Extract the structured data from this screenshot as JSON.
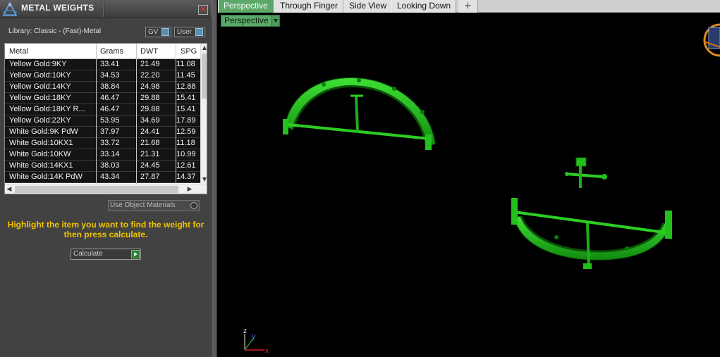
{
  "panel": {
    "title": "METAL WEIGHTS",
    "close_glyph": "✕",
    "library_label": "Library: Classic - (Fast)-Metal",
    "gv_label": "GV",
    "user_label": "User",
    "table": {
      "headers": [
        "Metal",
        "Grams",
        "DWT",
        "SPG"
      ],
      "rows": [
        [
          "Yellow Gold:9KY",
          "33.41",
          "21.49",
          "11.08"
        ],
        [
          "Yellow Gold:10KY",
          "34.53",
          "22.20",
          "11.45"
        ],
        [
          "Yellow Gold:14KY",
          "38.84",
          "24.98",
          "12.88"
        ],
        [
          "Yellow Gold:18KY",
          "46.47",
          "29.88",
          "15.41"
        ],
        [
          "Yellow Gold:18KY R...",
          "46.47",
          "29.88",
          "15.41"
        ],
        [
          "Yellow Gold:22KY",
          "53.95",
          "34.69",
          "17.89"
        ],
        [
          "White Gold:9K PdW",
          "37.97",
          "24.41",
          "12.59"
        ],
        [
          "White Gold:10KX1",
          "33.72",
          "21.68",
          "11.18"
        ],
        [
          "White Gold:10KW",
          "33.14",
          "21.31",
          "10.99"
        ],
        [
          "White Gold:14KX1",
          "38.03",
          "24.45",
          "12.61"
        ],
        [
          "White Gold:14K PdW",
          "43.34",
          "27.87",
          "14.37"
        ]
      ]
    },
    "use_object_materials_label": "Use Object Materials",
    "hint_text": "Highlight the item you want to find the weight for then press calculate.",
    "calculate_label": "Calculate"
  },
  "viewport": {
    "tabs": [
      "Perspective",
      "Through Finger",
      "Side View",
      "Looking Down"
    ],
    "active_tab": "Perspective",
    "add_tab_glyph": "+",
    "view_dropdown_label": "Perspective",
    "axis_labels": {
      "x": "x",
      "y": "y",
      "z": "z"
    }
  },
  "colors": {
    "model_green": "#22c01c",
    "accent_green": "#5ba86a",
    "hint_yellow": "#f2c400",
    "panel_bg": "#424242"
  }
}
